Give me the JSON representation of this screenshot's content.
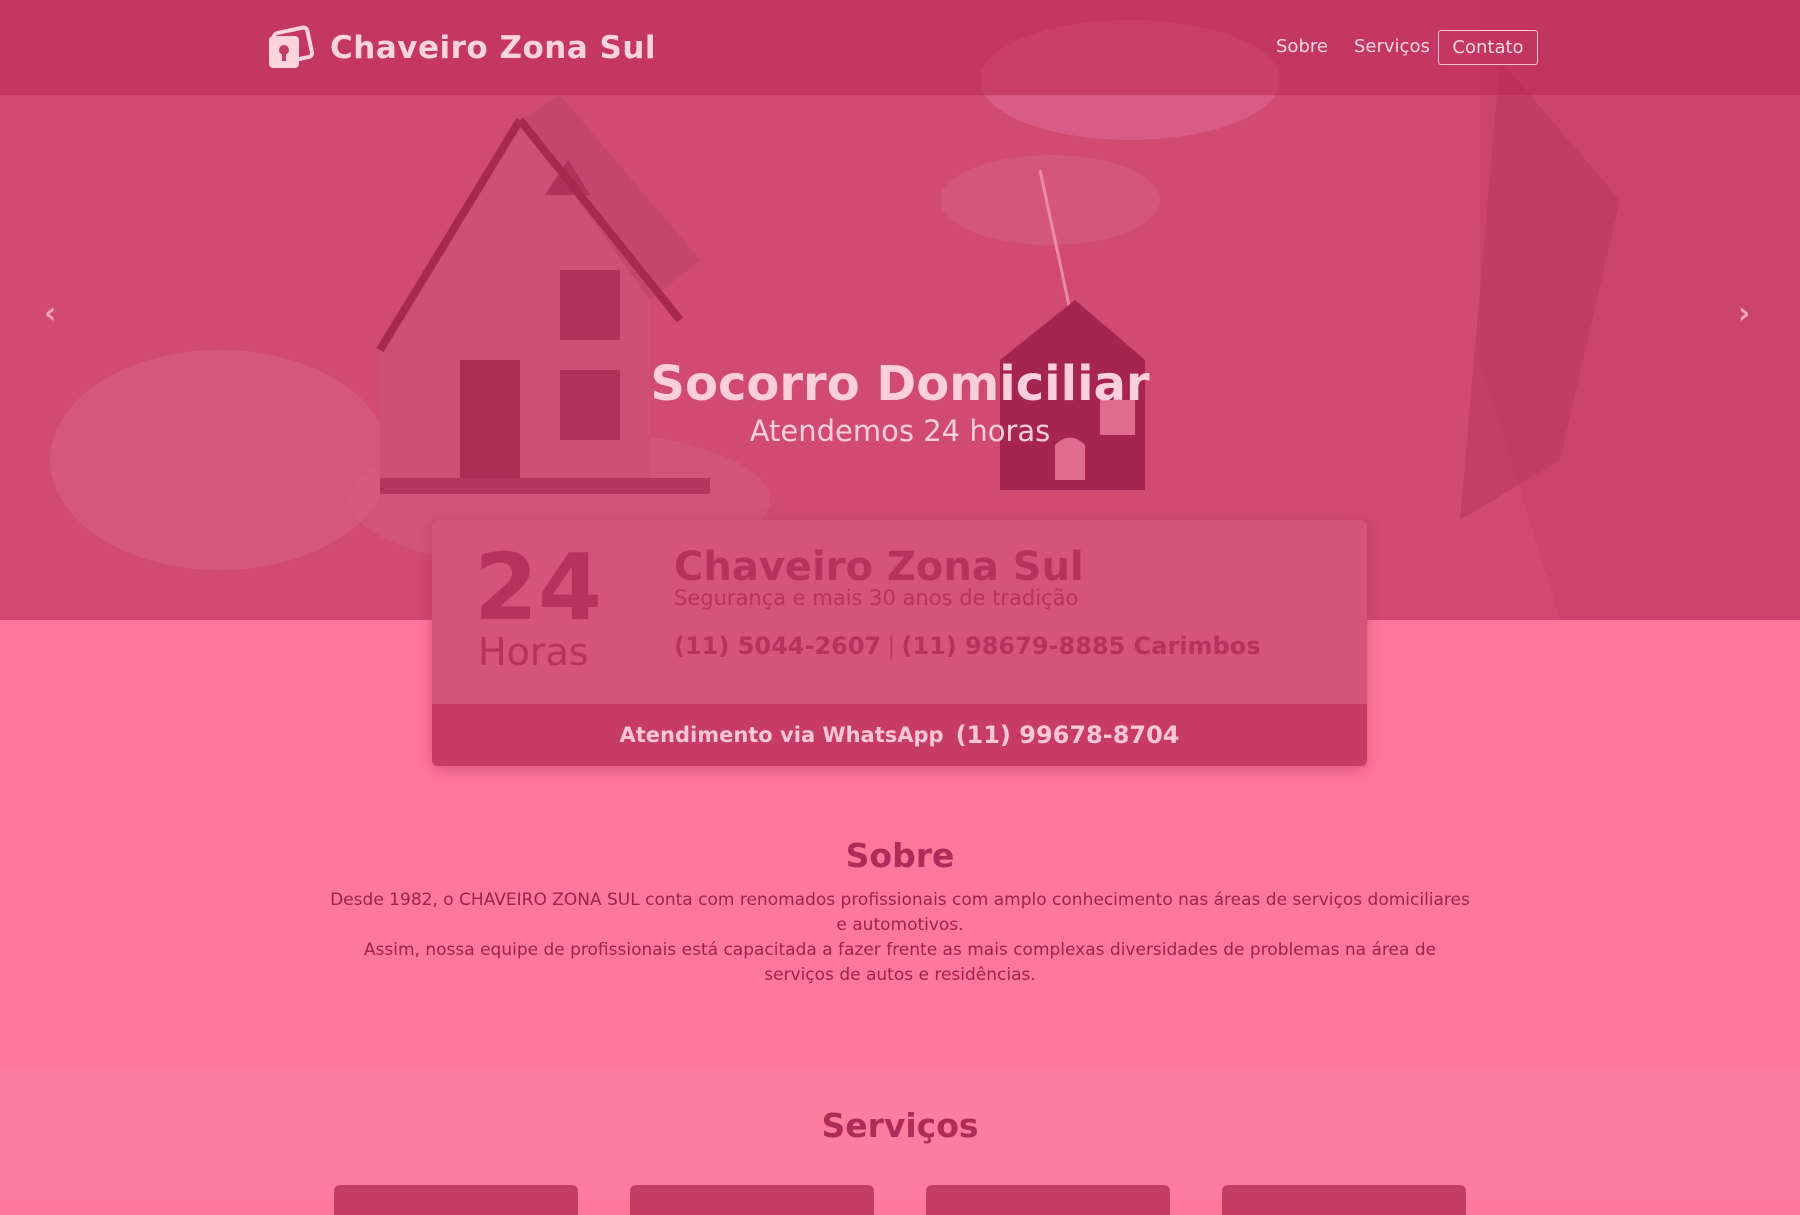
{
  "brand": {
    "name": "Chaveiro Zona Sul"
  },
  "nav": {
    "items": [
      "Sobre",
      "Serviços"
    ],
    "contact": "Contato"
  },
  "hero": {
    "title": "Socorro Domiciliar",
    "subtitle": "Atendemos 24 horas",
    "prev_arrow": "‹",
    "next_arrow": "›"
  },
  "card": {
    "hours_number": "24",
    "hours_label": "Horas",
    "title": "Chaveiro Zona Sul",
    "subtitle": "Segurança e mais 30 anos de tradição",
    "phone_1": "(11) 5044-2607",
    "separator": "|",
    "phone_2": "(11) 98679-8885 Carimbos",
    "whatsapp_label": "Atendimento via WhatsApp",
    "whatsapp_number": "(11) 99678-8704"
  },
  "about": {
    "title": "Sobre",
    "paragraph_1": "Desde 1982, o CHAVEIRO ZONA SUL conta com renomados profissionais com amplo conhecimento nas áreas de serviços domiciliares e automotivos.",
    "paragraph_2": "Assim, nossa equipe de profissionais está capacitada a fazer frente as mais complexas diversidades de problemas na área de serviços de autos e residências."
  },
  "services": {
    "title": "Serviços"
  },
  "colors": {
    "page_bg": "#fe789c",
    "hero_overlay": "#d14a73",
    "card_bg": "#d6537c",
    "card_footer": "#c63c66",
    "heading": "#b02c58"
  },
  "icons": {
    "logo": "lock-box-icon",
    "prev": "chevron-left-icon",
    "next": "chevron-right-icon"
  }
}
